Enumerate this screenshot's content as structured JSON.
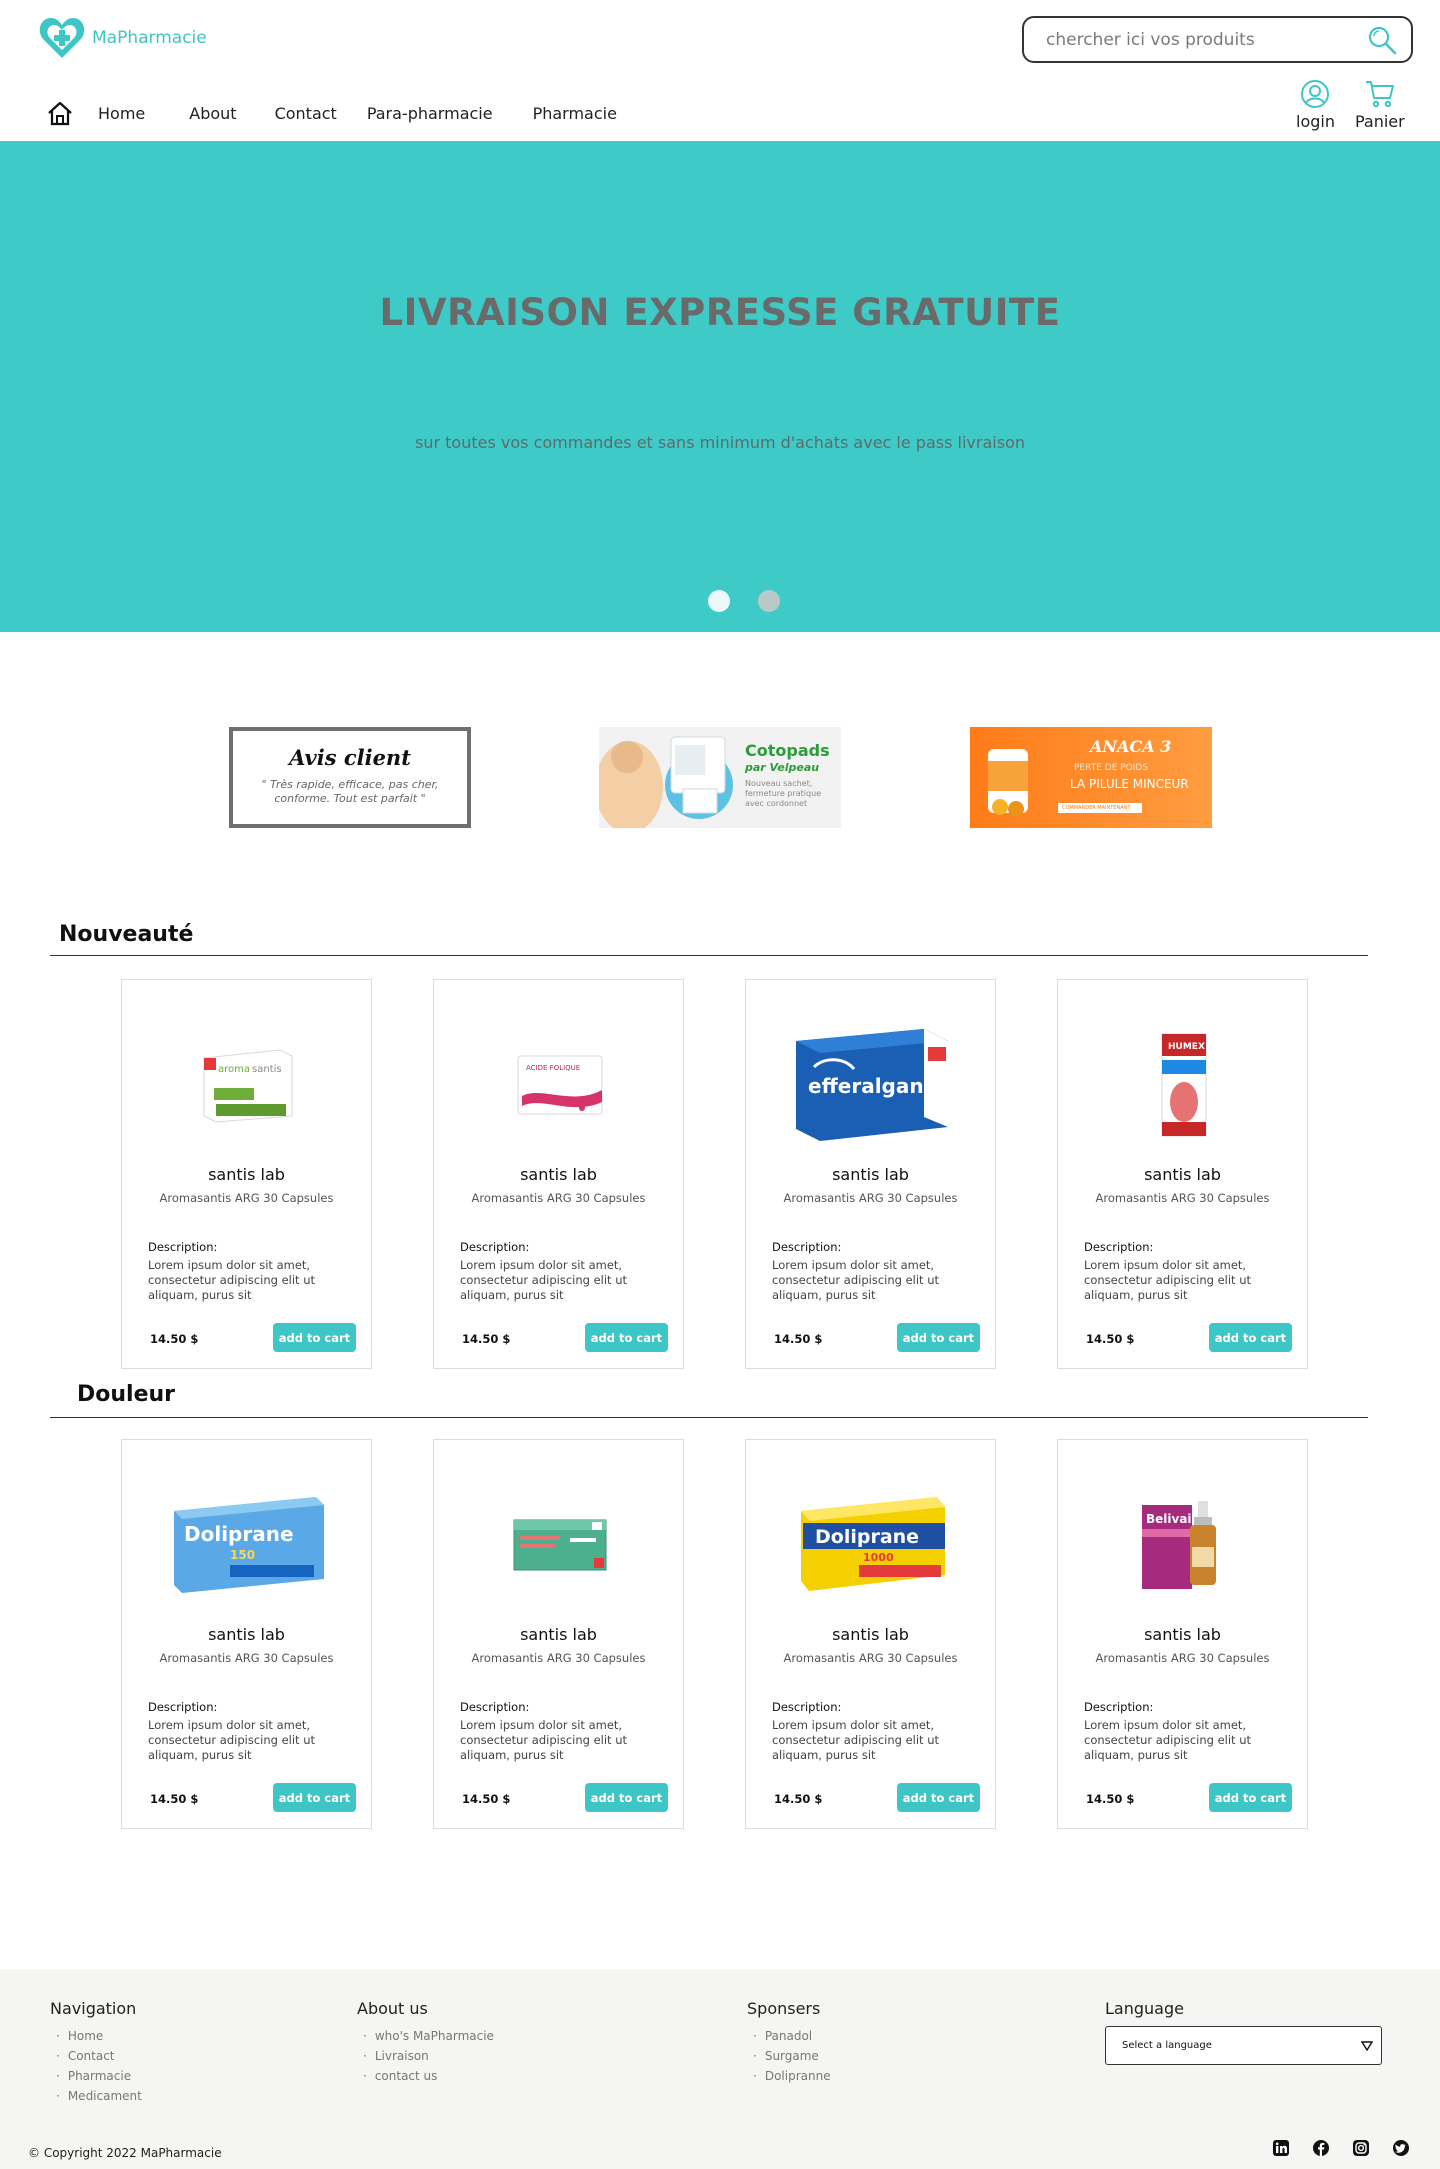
{
  "brand": {
    "name": "MaPharmacie",
    "accent": "#3ec6c6"
  },
  "search": {
    "placeholder": "chercher ici vos produits"
  },
  "nav": {
    "items": [
      "Home",
      "About",
      "Contact",
      "Para-pharmacie",
      "Pharmacie"
    ]
  },
  "user": {
    "login_label": "login",
    "cart_label": "Panier"
  },
  "hero": {
    "title": "LIVRAISON EXPRESSE GRATUITE",
    "subtitle": "sur toutes vos commandes et sans minimum d'achats avec le pass livraison",
    "slide_count": 2,
    "active_slide": 1,
    "background": "#3ecbc8"
  },
  "promos": {
    "avis": {
      "title": "Avis client",
      "quote": "\" Très rapide, efficace, pas cher, conforme. Tout est parfait \""
    },
    "cotopads": {
      "brand": "Cotopads",
      "by": "par Velpeau",
      "text": "Nouveau sachet, fermeture pratique avec cordonnet"
    },
    "anaca": {
      "brand": "ANACA 3",
      "line1": "PERTE DE POIDS",
      "line2": "LA PILULE MINCEUR",
      "cta": "COMMANDER MAINTENANT"
    }
  },
  "sections": [
    {
      "title": "Nouveauté",
      "products": [
        {
          "name": "santis lab",
          "subtitle": "Aromasantis  ARG 30 Capsules",
          "desc_label": "Description:",
          "desc": "Lorem ipsum dolor sit amet, consectetur adipiscing elit ut aliquam, purus sit",
          "price": "14.50 $",
          "cta": "add to cart",
          "image_icon": "aromasantis-box",
          "box_text": "aromasantis"
        },
        {
          "name": "santis lab",
          "subtitle": "Aromasantis  ARG 30 Capsules",
          "desc_label": "Description:",
          "desc": "Lorem ipsum dolor sit amet, consectetur adipiscing elit ut aliquam, purus sit",
          "price": "14.50 $",
          "cta": "add to cart",
          "image_icon": "acide-folique-box",
          "box_text": "ACIDE FOLIQUE"
        },
        {
          "name": "santis lab",
          "subtitle": "Aromasantis  ARG 30 Capsules",
          "desc_label": "Description:",
          "desc": "Lorem ipsum dolor sit amet, consectetur adipiscing elit ut aliquam, purus sit",
          "price": "14.50 $",
          "cta": "add to cart",
          "image_icon": "efferalgan-box",
          "box_text": "efferalgan"
        },
        {
          "name": "santis lab",
          "subtitle": "Aromasantis  ARG 30 Capsules",
          "desc_label": "Description:",
          "desc": "Lorem ipsum dolor sit amet, consectetur adipiscing elit ut aliquam, purus sit",
          "price": "14.50 $",
          "cta": "add to cart",
          "image_icon": "humex-box",
          "box_text": "HUMEX"
        }
      ]
    },
    {
      "title": "Douleur",
      "products": [
        {
          "name": "santis lab",
          "subtitle": "Aromasantis  ARG 30 Capsules",
          "desc_label": "Description:",
          "desc": "Lorem ipsum dolor sit amet, consectetur adipiscing elit ut aliquam, purus sit",
          "price": "14.50 $",
          "cta": "add to cart",
          "image_icon": "doliprane-150-box",
          "box_text": "Doliprane"
        },
        {
          "name": "santis lab",
          "subtitle": "Aromasantis  ARG 30 Capsules",
          "desc_label": "Description:",
          "desc": "Lorem ipsum dolor sit amet, consectetur adipiscing elit ut aliquam, purus sit",
          "price": "14.50 $",
          "cta": "add to cart",
          "image_icon": "green-medicine-box",
          "box_text": ""
        },
        {
          "name": "santis lab",
          "subtitle": "Aromasantis  ARG 30 Capsules",
          "desc_label": "Description:",
          "desc": "Lorem ipsum dolor sit amet, consectetur adipiscing elit ut aliquam, purus sit",
          "price": "14.50 $",
          "cta": "add to cart",
          "image_icon": "doliprane-1000-box",
          "box_text": "Doliprane"
        },
        {
          "name": "santis lab",
          "subtitle": "Aromasantis  ARG 30 Capsules",
          "desc_label": "Description:",
          "desc": "Lorem ipsum dolor sit amet, consectetur adipiscing elit ut aliquam, purus sit",
          "price": "14.50 $",
          "cta": "add to cart",
          "image_icon": "belivair-box",
          "box_text": "Belivair"
        }
      ]
    }
  ],
  "footer": {
    "navigation": {
      "title": "Navigation",
      "items": [
        "Home",
        "Contact",
        "Pharmacie",
        "Medicament"
      ]
    },
    "about": {
      "title": "About us",
      "items": [
        "who's MaPharmacie",
        "Livraison",
        "contact us"
      ]
    },
    "sponsors": {
      "title": "Sponsers",
      "items": [
        "Panadol",
        "Surgame",
        "Dolipranne"
      ]
    },
    "language": {
      "title": "Language",
      "select_value": "Select a language"
    },
    "copyright": "© Copyright 2022 MaPharmacie",
    "socials": [
      "linkedin-icon",
      "facebook-icon",
      "instagram-icon",
      "twitter-icon"
    ]
  }
}
